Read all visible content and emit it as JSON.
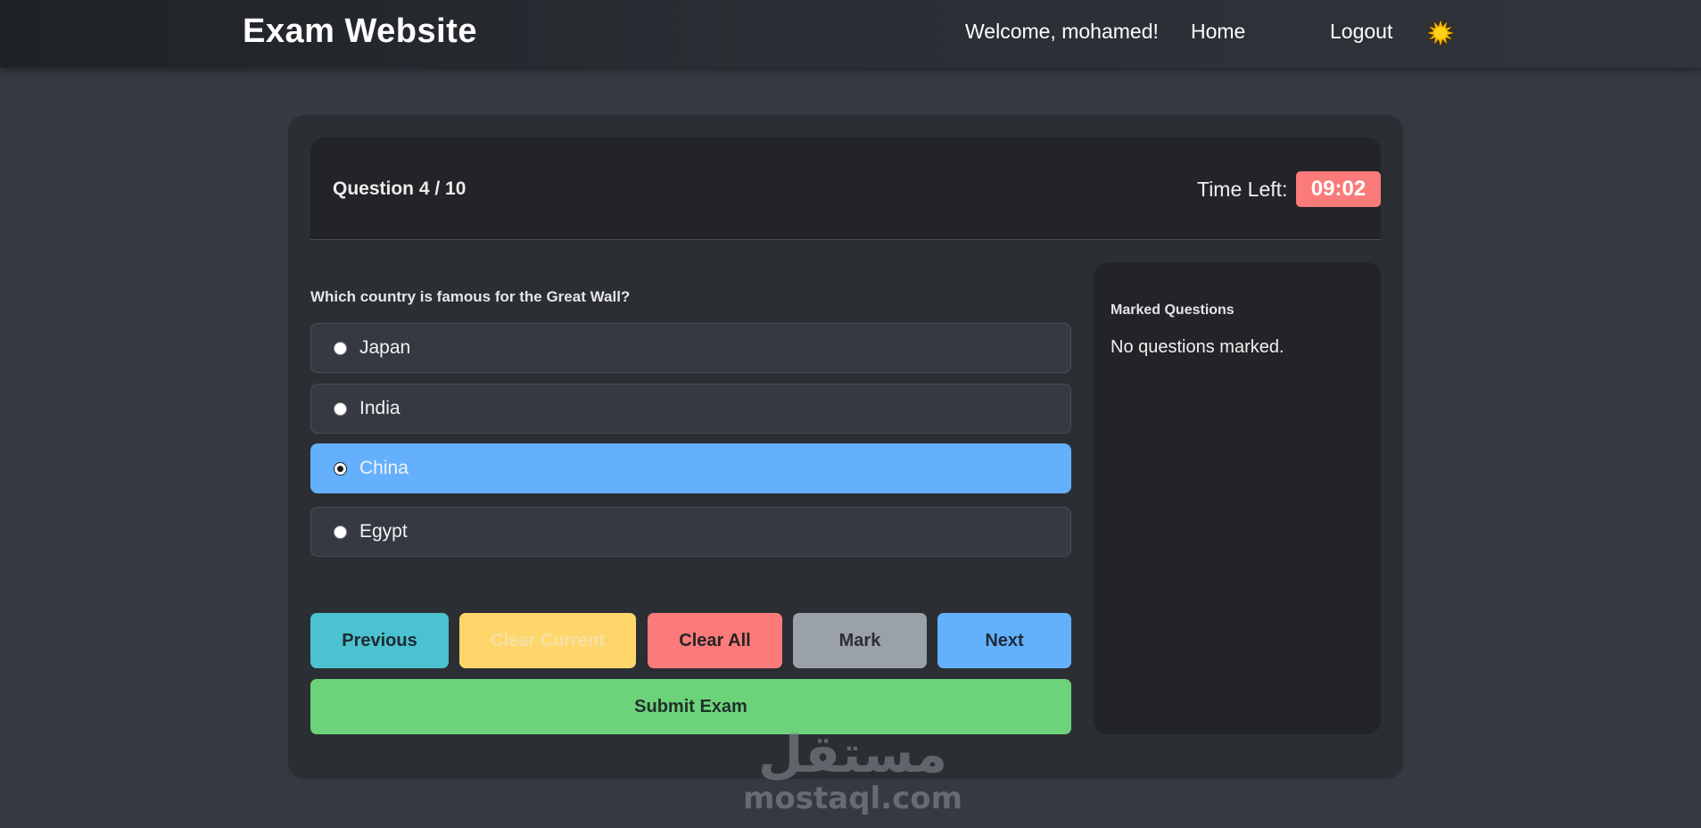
{
  "navbar": {
    "brand": "Exam Website",
    "welcome": "Welcome, mohamed!",
    "home": "Home",
    "logout": "Logout",
    "theme_icon": "sun-icon"
  },
  "exam": {
    "question_counter": "Question 4 / 10",
    "time_label": "Time Left:",
    "timer": "09:02",
    "question": "Which country is famous for the Great Wall?",
    "options": [
      {
        "label": "Japan",
        "selected": false
      },
      {
        "label": "India",
        "selected": false
      },
      {
        "label": "China",
        "selected": true
      },
      {
        "label": "Egypt",
        "selected": false
      }
    ],
    "buttons": {
      "previous": "Previous",
      "clear_current": "Clear Current",
      "clear_all": "Clear All",
      "mark": "Mark",
      "next": "Next",
      "submit": "Submit Exam"
    }
  },
  "marked": {
    "title": "Marked Questions",
    "empty": "No questions marked."
  },
  "watermark": {
    "arabic": "مستقل",
    "latin": "mostaql.com"
  },
  "colors": {
    "selected_option": "#64b0fd",
    "timer_bg": "#fb7a7a",
    "previous": "#4cc1d0",
    "clear_current": "#ffd66b",
    "clear_all": "#fc7a7a",
    "mark": "#9ba1a8",
    "next": "#63b1fd",
    "submit": "#6cd37b"
  }
}
